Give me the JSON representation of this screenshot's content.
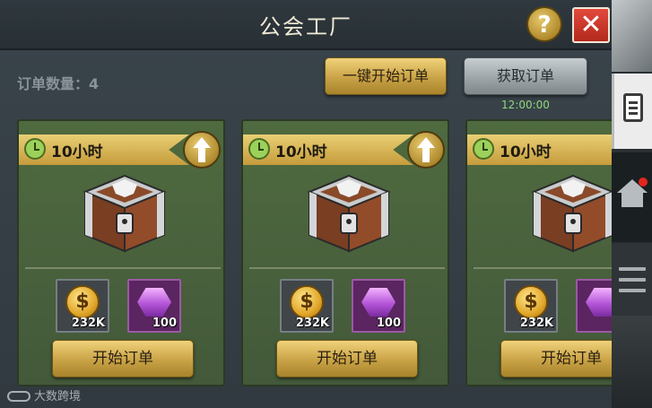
{
  "window": {
    "title": "公会工厂",
    "help_label": "?",
    "close_label": "✕"
  },
  "toolbar": {
    "order_count_label": "订单数量：4",
    "start_all_label": "一键开始订单",
    "get_orders_label": "获取订单",
    "timer": "12:00:00"
  },
  "cards": [
    {
      "duration": "10小时",
      "reward_coin": "232K",
      "reward_gem": "100",
      "start_label": "开始订单"
    },
    {
      "duration": "10小时",
      "reward_coin": "232K",
      "reward_gem": "100",
      "start_label": "开始订单"
    },
    {
      "duration": "10小时",
      "reward_coin": "232K",
      "reward_gem": "1",
      "start_label": "开始订单"
    }
  ],
  "icons": {
    "coin_symbol": "$"
  },
  "watermark": "大数跨境",
  "colors": {
    "card_green": "#4f6a3f",
    "gold_button": "#c9a246",
    "gray_button": "#9aa2a6",
    "close_red": "#d13a2d",
    "timer_green": "#8fd97b"
  }
}
